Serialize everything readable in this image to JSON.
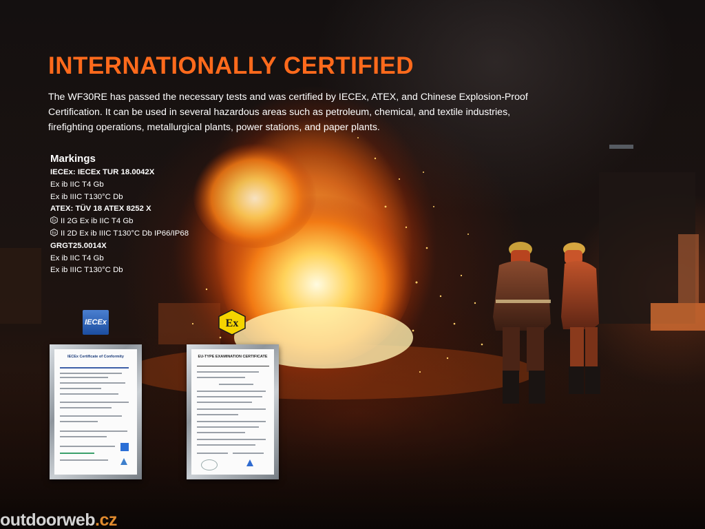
{
  "heading": "INTERNATIONALLY CERTIFIED",
  "intro": "The WF30RE has passed the necessary tests and was certified by IECEx, ATEX, and Chinese Explosion-Proof Certification. It can be used in several hazardous areas such as petroleum, chemical, and textile industries, firefighting operations, metallurgical plants, power stations, and paper plants.",
  "markings": {
    "title": "Markings",
    "lines": [
      {
        "text": "IECEx: IECEx TUR 18.0042X"
      },
      {
        "text": "Ex ib IIC T4 Gb"
      },
      {
        "text": "Ex ib IIIC T130°C Db"
      },
      {
        "text": "ATEX: TÜV 18 ATEX 8252 X"
      },
      {
        "text": "II 2G Ex ib IIC T4 Gb",
        "icon": "ex-hexagon-icon"
      },
      {
        "text": "II 2D Ex ib IIIC T130°C Db IP66/IP68",
        "icon": "ex-hexagon-icon"
      },
      {
        "text": "GRGT25.0014X"
      },
      {
        "text": "Ex ib IIC T4 Gb"
      },
      {
        "text": "Ex ib IIIC T130°C Db"
      }
    ]
  },
  "logos": {
    "iecex": "IECEx",
    "atex": "Ex"
  },
  "certificates": {
    "iecex_title": "IECEx Certificate of Conformity",
    "atex_title": "EU-TYPE EXAMINATION CERTIFICATE"
  },
  "watermark": {
    "brand": "outdoorweb",
    "tld": ".cz"
  },
  "colors": {
    "heading": "#ff6a1c",
    "text": "#ffffff",
    "atex_yellow": "#f5d400",
    "iecex_blue": "#2a5cb5"
  }
}
